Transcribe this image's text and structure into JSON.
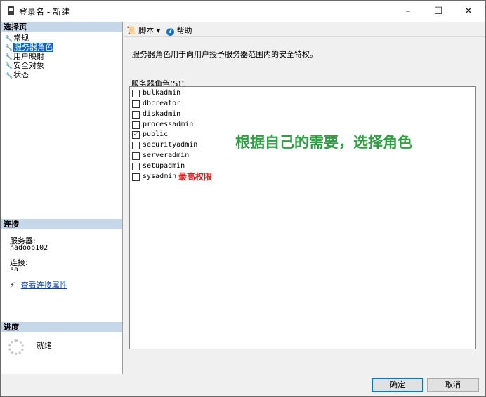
{
  "window": {
    "title": "登录名 - 新建",
    "minimize": "–",
    "maximize": "☐",
    "close": "✕"
  },
  "left": {
    "select_page_header": "选择页",
    "nav": [
      {
        "label": "常规",
        "icon": "wrench-icon"
      },
      {
        "label": "服务器角色",
        "icon": "wrench-icon",
        "selected": true
      },
      {
        "label": "用户映射",
        "icon": "wrench-icon"
      },
      {
        "label": "安全对象",
        "icon": "wrench-icon"
      },
      {
        "label": "状态",
        "icon": "wrench-icon"
      }
    ],
    "connection_header": "连接",
    "server_label": "服务器:",
    "server_value": "hadoop102",
    "connect_label": "连接:",
    "connect_value": "sa",
    "view_props_link": "查看连接属性",
    "progress_header": "进度",
    "progress_status": "就绪"
  },
  "toolbar": {
    "script_label": "脚本",
    "help_label": "帮助"
  },
  "main": {
    "description": "服务器角色用于向用户授予服务器范围内的安全特权。",
    "roles_label": "服务器角色(S)：",
    "roles": [
      {
        "name": "bulkadmin",
        "checked": false
      },
      {
        "name": "dbcreator",
        "checked": false
      },
      {
        "name": "diskadmin",
        "checked": false
      },
      {
        "name": "processadmin",
        "checked": false
      },
      {
        "name": "public",
        "checked": true
      },
      {
        "name": "securityadmin",
        "checked": false
      },
      {
        "name": "serveradmin",
        "checked": false
      },
      {
        "name": "setupadmin",
        "checked": false
      },
      {
        "name": "sysadmin",
        "checked": false
      }
    ],
    "annotation_main": "根据自己的需要，选择角色",
    "annotation_sysadmin": "最高权限",
    "annotation_main_color": "#2ea043",
    "annotation_sysadmin_color": "#e02020"
  },
  "buttons": {
    "ok": "确定",
    "cancel": "取消"
  }
}
